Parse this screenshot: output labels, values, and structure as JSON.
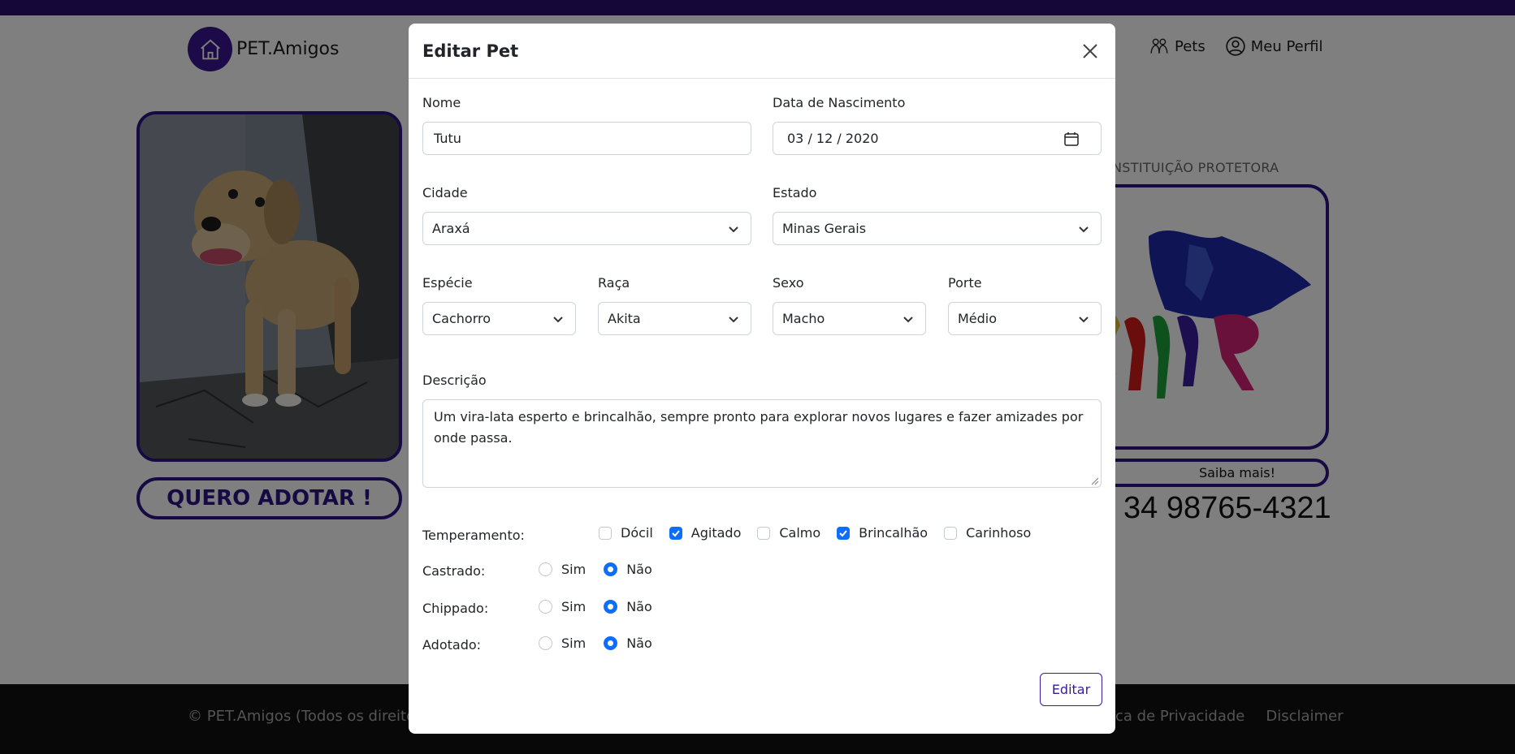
{
  "navbar": {
    "brand": "PET.Amigos",
    "links": [
      "Pets",
      "Meu Perfil"
    ]
  },
  "pet_page": {
    "adopt_button": "QUERO ADOTAR !",
    "institution_title": "INSTITUIÇÃO PROTETORA",
    "saiba_mais": "Saiba mais!",
    "phone": "34 98765-4321"
  },
  "footer": {
    "copyright": "© PET.Amigos (Todos os direitos",
    "links": [
      "ca de Privacidade",
      "Disclaimer"
    ]
  },
  "modal": {
    "title": "Editar Pet",
    "fields": {
      "nome": {
        "label": "Nome",
        "value": "Tutu"
      },
      "nascimento": {
        "label": "Data de Nascimento",
        "value": "03 / 12 / 2020"
      },
      "cidade": {
        "label": "Cidade",
        "value": "Araxá"
      },
      "estado": {
        "label": "Estado",
        "value": "Minas Gerais"
      },
      "especie": {
        "label": "Espécie",
        "value": "Cachorro"
      },
      "raca": {
        "label": "Raça",
        "value": "Akita"
      },
      "sexo": {
        "label": "Sexo",
        "value": "Macho"
      },
      "porte": {
        "label": "Porte",
        "value": "Médio"
      },
      "descricao": {
        "label": "Descrição",
        "value": "Um vira-lata esperto e brincalhão, sempre pronto para explorar novos lugares e fazer amizades por onde passa."
      }
    },
    "temperamento": {
      "label": "Temperamento:",
      "options": [
        {
          "label": "Dócil",
          "checked": false
        },
        {
          "label": "Agitado",
          "checked": true
        },
        {
          "label": "Calmo",
          "checked": false
        },
        {
          "label": "Brincalhão",
          "checked": true
        },
        {
          "label": "Carinhoso",
          "checked": false
        }
      ]
    },
    "radios": [
      {
        "label": "Castrado:",
        "yes": "Sim",
        "no": "Não",
        "value": "Não"
      },
      {
        "label": "Chippado:",
        "yes": "Sim",
        "no": "Não",
        "value": "Não"
      },
      {
        "label": "Adotado:",
        "yes": "Sim",
        "no": "Não",
        "value": "Não"
      }
    ],
    "submit_label": "Editar"
  },
  "colors": {
    "brand_purple": "#2f1486",
    "checkbox_blue": "#0d6efd"
  }
}
